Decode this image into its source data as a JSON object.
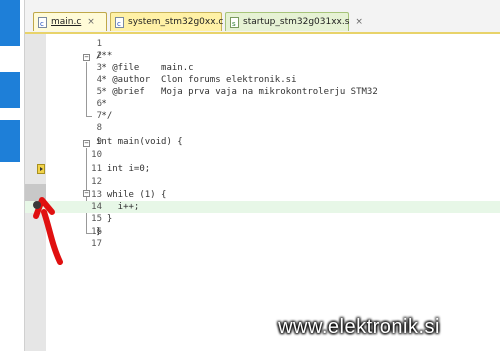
{
  "tabs": [
    {
      "label": "main.c",
      "close": "×"
    },
    {
      "label": "system_stm32g0xx.c",
      "close": "×"
    },
    {
      "label": "startup_stm32g031xx.s",
      "close": "×"
    }
  ],
  "code_lines": [
    {
      "num": "1",
      "text": ""
    },
    {
      "num": "2",
      "text": "/**"
    },
    {
      "num": "3",
      "text": " * @file    main.c"
    },
    {
      "num": "4",
      "text": " * @author  Clon forums elektronik.si"
    },
    {
      "num": "5",
      "text": " * @brief   Moja prva vaja na mikrokontrolerju STM32"
    },
    {
      "num": "6",
      "text": " *"
    },
    {
      "num": "7",
      "text": " */"
    },
    {
      "num": "8",
      "text": ""
    },
    {
      "num": "9",
      "text": "int main(void) {"
    },
    {
      "num": "10",
      "text": ""
    },
    {
      "num": "11",
      "text": "  int i=0;"
    },
    {
      "num": "12",
      "text": ""
    },
    {
      "num": "13",
      "text": "  while (1) {"
    },
    {
      "num": "14",
      "text": "    i++;"
    },
    {
      "num": "15",
      "text": "  }"
    },
    {
      "num": "16",
      "text": "}"
    },
    {
      "num": "17",
      "text": ""
    }
  ],
  "watermark": "www.elektronik.si",
  "colors": {
    "accent": "#1e7fd8",
    "current_line": "#e7f7e7",
    "arrow": "#e01010"
  }
}
